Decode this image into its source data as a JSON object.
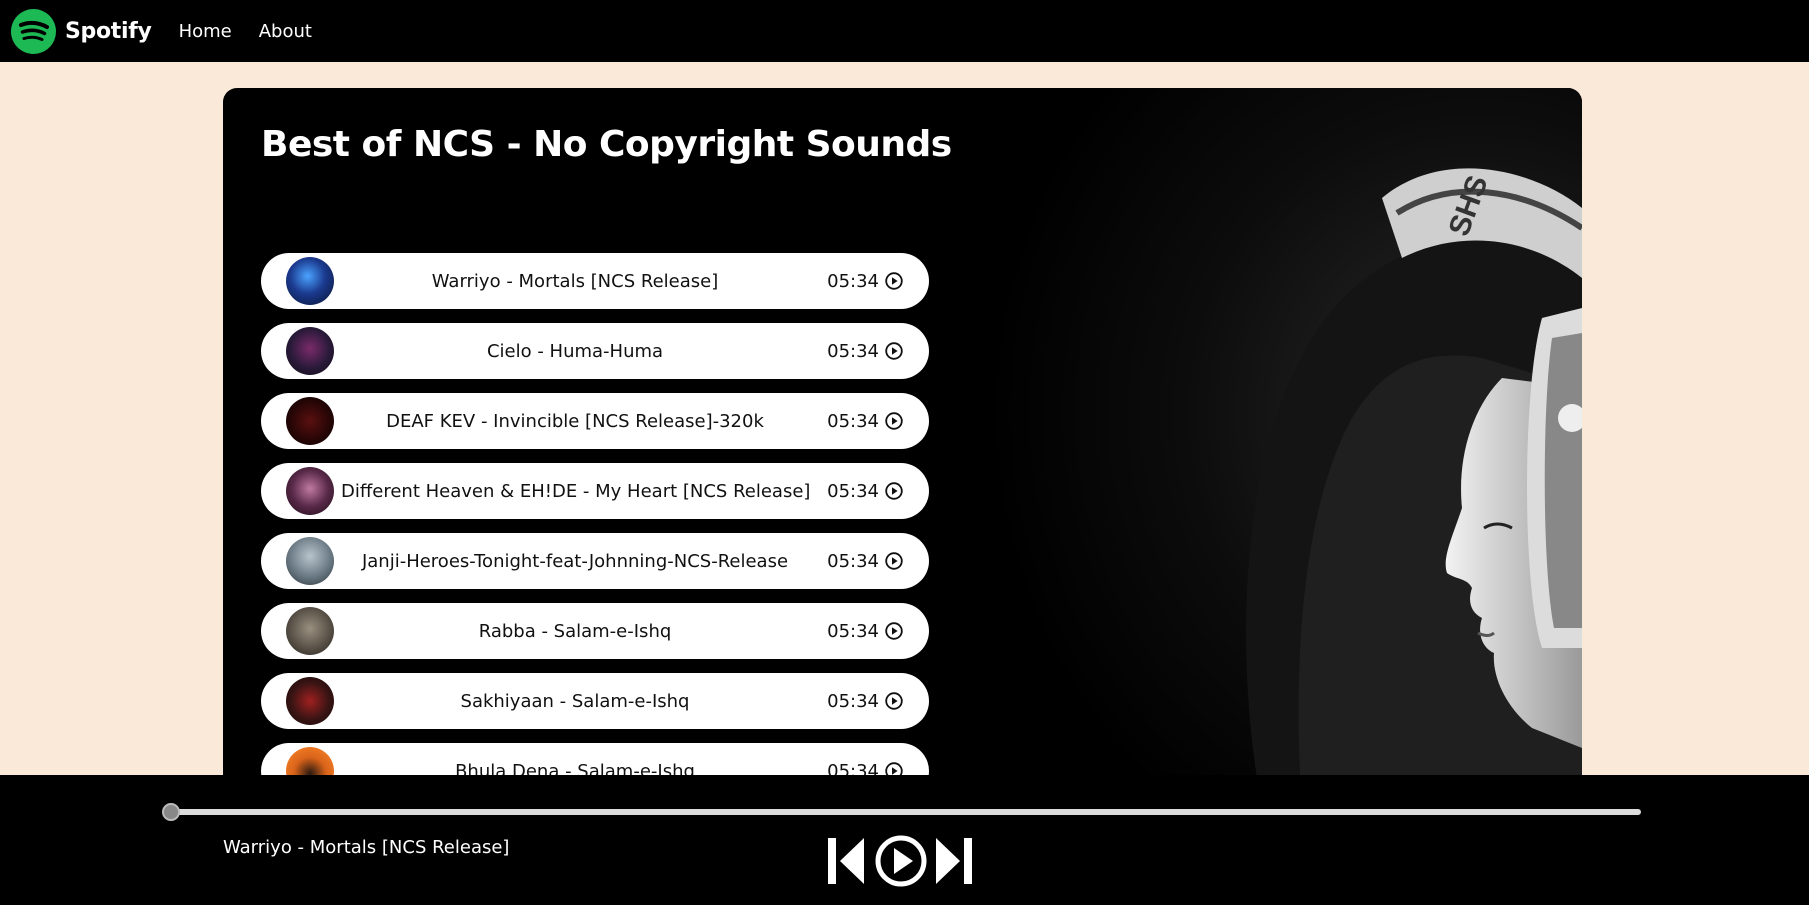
{
  "nav": {
    "brand": "Spotify",
    "links": [
      "Home",
      "About"
    ]
  },
  "playlist": {
    "title": "Best of NCS - No Copyright Sounds",
    "songs": [
      {
        "name": "Warriyo - Mortals [NCS Release]",
        "duration": "05:34",
        "cover_color": "#1b3a8f"
      },
      {
        "name": "Cielo - Huma-Huma",
        "duration": "05:34",
        "cover_color": "#3a1a4a"
      },
      {
        "name": "DEAF KEV - Invincible [NCS Release]-320k",
        "duration": "05:34",
        "cover_color": "#3a0b0b"
      },
      {
        "name": "Different Heaven & EH!DE - My Heart [NCS Release]",
        "duration": "05:34",
        "cover_color": "#5a2a4a"
      },
      {
        "name": "Janji-Heroes-Tonight-feat-Johnning-NCS-Release",
        "duration": "05:34",
        "cover_color": "#7a8a94"
      },
      {
        "name": "Rabba - Salam-e-Ishq",
        "duration": "05:34",
        "cover_color": "#5a5248"
      },
      {
        "name": "Sakhiyaan - Salam-e-Ishq",
        "duration": "05:34",
        "cover_color": "#3a1414"
      },
      {
        "name": "Bhula Dena - Salam-e-Ishq",
        "duration": "05:34",
        "cover_color": "#d9631a"
      }
    ]
  },
  "player": {
    "now_playing": "Warriyo - Mortals [NCS Release]",
    "progress": 0,
    "icons": [
      "previous-icon",
      "play-circle-icon",
      "next-icon"
    ]
  },
  "colors": {
    "background": "#fae9d8",
    "nav": "#000000",
    "spotify_green": "#1DB954"
  }
}
